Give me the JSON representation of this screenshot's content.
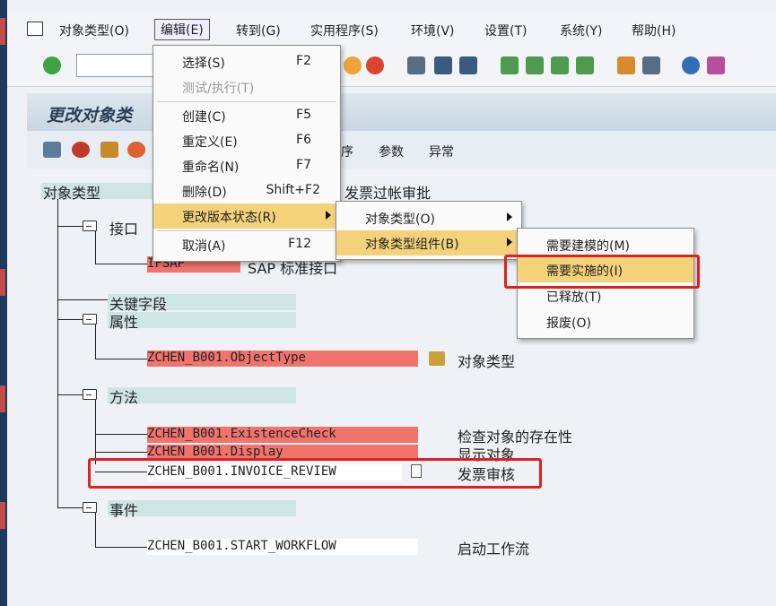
{
  "menubar": {
    "items": [
      "对象类型(O)",
      "编辑(E)",
      "转到(G)",
      "实用程序(S)",
      "环境(V)",
      "设置(T)",
      "系统(Y)",
      "帮助(H)"
    ]
  },
  "title": "更改对象类",
  "app_toolbar": {
    "tabs": [
      "序",
      "参数",
      "异常"
    ]
  },
  "tree": {
    "root": "对象类型",
    "root_desc": "发票过帐审批",
    "interface_folder": "接口",
    "interface_item": "IFSAP",
    "interface_desc": "SAP 标准接口",
    "keyfields": "关键字段",
    "attributes": "属性",
    "attr_item": "ZCHEN_B001.ObjectType",
    "attr_desc": "对象类型",
    "methods": "方法",
    "method_items": [
      {
        "name": "ZCHEN_B001.ExistenceCheck",
        "desc": "检查对象的存在性"
      },
      {
        "name": "ZCHEN_B001.Display",
        "desc": "显示对象"
      },
      {
        "name": "ZCHEN_B001.INVOICE_REVIEW",
        "desc": "发票审核"
      }
    ],
    "events": "事件",
    "event_item": "ZCHEN_B001.START_WORKFLOW",
    "event_desc": "启动工作流"
  },
  "edit_menu": {
    "items": [
      {
        "label": "选择(S)",
        "shortcut": "F2"
      },
      {
        "label": "测试/执行(T)",
        "shortcut": ""
      },
      {
        "label": "创建(C)",
        "shortcut": "F5"
      },
      {
        "label": "重定义(E)",
        "shortcut": "F6"
      },
      {
        "label": "重命名(N)",
        "shortcut": "F7"
      },
      {
        "label": "删除(D)",
        "shortcut": "Shift+F2"
      },
      {
        "label": "更改版本状态(R)",
        "shortcut": ""
      },
      {
        "label": "取消(A)",
        "shortcut": "F12"
      }
    ]
  },
  "version_menu": {
    "items": [
      "对象类型(O)",
      "对象类型组件(B)"
    ]
  },
  "component_menu": {
    "items": [
      "需要建模的(M)",
      "需要实施的(I)",
      "已释放(T)",
      "报废(O)"
    ]
  },
  "colors": {
    "highlight": "#f3d27a",
    "red_box": "#e02020",
    "method_red": "#f0736c"
  }
}
